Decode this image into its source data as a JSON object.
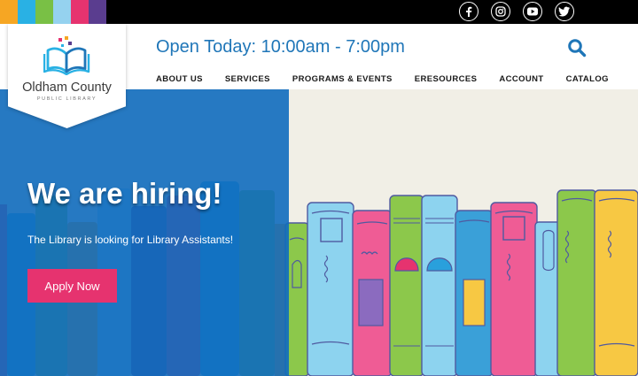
{
  "brand": {
    "name": "Oldham County",
    "subtitle": "PUBLIC LIBRARY",
    "strip_colors": [
      "#f6a623",
      "#29b1e4",
      "#79c045",
      "#95d2ef",
      "#e6336f",
      "#5a3d8f"
    ]
  },
  "social": [
    {
      "icon": "facebook-icon"
    },
    {
      "icon": "instagram-icon"
    },
    {
      "icon": "youtube-icon"
    },
    {
      "icon": "twitter-icon"
    }
  ],
  "header": {
    "hours": "Open Today: 10:00am - 7:00pm",
    "search_icon": "search-icon"
  },
  "nav": [
    {
      "label": "ABOUT US"
    },
    {
      "label": "SERVICES"
    },
    {
      "label": "PROGRAMS & EVENTS"
    },
    {
      "label": "ERESOURCES"
    },
    {
      "label": "ACCOUNT"
    },
    {
      "label": "CATALOG"
    }
  ],
  "hero": {
    "title": "We are hiring!",
    "subtitle": "The Library is looking for Library Assistants!",
    "cta": "Apply Now"
  },
  "colors": {
    "accent_blue": "#1f76b8",
    "cta_pink": "#e6336f",
    "hero_background": "#f1efe6"
  }
}
